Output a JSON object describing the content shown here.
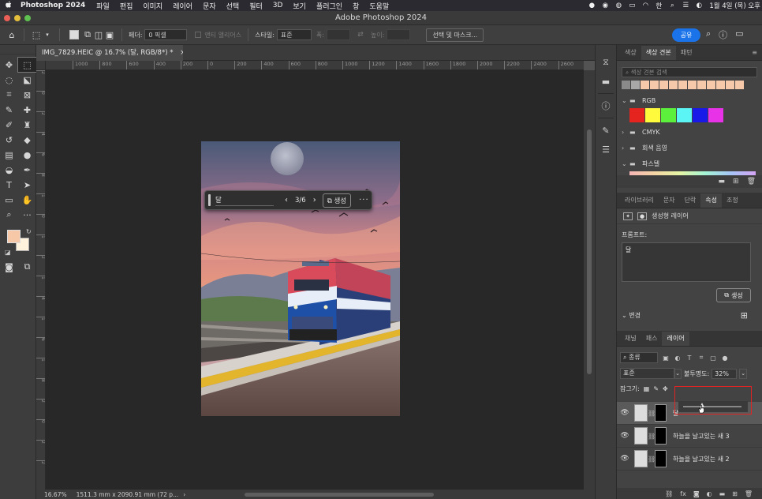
{
  "menubar": {
    "app": "Photoshop 2024",
    "items": [
      "파일",
      "편집",
      "이미지",
      "레이어",
      "문자",
      "선택",
      "필터",
      "3D",
      "보기",
      "플러그인",
      "창",
      "도움말"
    ],
    "status_icons": [
      "record-icon",
      "creative-cloud-icon",
      "notification-icon",
      "battery-icon",
      "wifi-icon",
      "input-source-icon",
      "search-icon",
      "control-center-icon",
      "siri-icon"
    ],
    "input_source": "한",
    "datetime": "1월 4일 (목) 오후"
  },
  "window": {
    "title": "Adobe Photoshop 2024"
  },
  "options_bar": {
    "feather_label": "페더:",
    "feather_value": "0 픽셀",
    "antialias_label": "앤티 앨리어스",
    "style_label": "스타일:",
    "style_value": "표준",
    "width_label": "폭:",
    "height_label": "높이:",
    "select_mask_button": "선택 및 마스크...",
    "share_button": "공유"
  },
  "document": {
    "tab_title": "IMG_7829.HEIC @ 16.7% (달, RGB/8*) *",
    "ruler_top": [
      "1000",
      "800",
      "600",
      "400",
      "200",
      "0",
      "200",
      "400",
      "600",
      "800",
      "1000",
      "1200",
      "1400",
      "1600",
      "1800",
      "2000",
      "2200",
      "2400",
      "2600",
      "2800"
    ],
    "ruler_left": [
      "2",
      "0",
      "2",
      "4",
      "6",
      "8",
      "1",
      "0",
      "1",
      "2",
      "1",
      "4",
      "1",
      "6",
      "1",
      "8",
      "2",
      "0",
      "2",
      "2"
    ]
  },
  "gen_bar": {
    "prompt": "달",
    "counter": "3/6",
    "generate_button": "생성"
  },
  "status_bar": {
    "zoom": "16.67%",
    "doc_info": "1511.3 mm x 2090.91 mm (72 p..."
  },
  "swatches_panel": {
    "tabs": [
      "색상",
      "색상 견본",
      "패턴"
    ],
    "active_tab": "색상 견본",
    "search_placeholder": "색상 견본 검색",
    "recent": [
      "#8a8a8a",
      "#a8a8a8",
      "#f5c9a9",
      "#f5c9a9",
      "#f5c9a9",
      "#f5c9a9",
      "#f5c9a9",
      "#f5c9a9",
      "#f5c9a9",
      "#f5c9a9",
      "#f5c9a9",
      "#f5c9a9",
      "#f5c9a9"
    ],
    "folders": [
      {
        "name": "RGB",
        "open": true,
        "colors": [
          "#e52420",
          "#fffa3c",
          "#5cf03c",
          "#5cf5f5",
          "#1a1ae8",
          "#e832e8"
        ]
      },
      {
        "name": "CMYK",
        "open": false
      },
      {
        "name": "회색 음영",
        "open": false
      },
      {
        "name": "파스텔",
        "open": true
      }
    ]
  },
  "properties_panel": {
    "tabs": [
      "라이브러리",
      "문자",
      "단락",
      "속성",
      "조정"
    ],
    "active_tab": "속성",
    "layer_type": "생성형 레이어",
    "prompt_label": "프롬프트:",
    "prompt_value": "달",
    "generate_button": "생성",
    "variations_label": "변경"
  },
  "layers_panel": {
    "tabs": [
      "채널",
      "패스",
      "레이어"
    ],
    "active_tab": "레이어",
    "filter_kind": "종류",
    "blend_mode": "표준",
    "opacity_label": "불투명도:",
    "opacity_value": "32%",
    "opacity_fraction": 0.32,
    "lock_label": "잠그기:",
    "layers": [
      {
        "name": "달",
        "selected": true
      },
      {
        "name": "하늘을 날고있는 새 3",
        "selected": false
      },
      {
        "name": "하늘을 날고있는 새 2",
        "selected": false
      }
    ]
  },
  "colors": {
    "foreground": "#f7c8a8",
    "background": "#fff2dd",
    "accent": "#1a73e8",
    "highlight_box": "#e02424"
  }
}
